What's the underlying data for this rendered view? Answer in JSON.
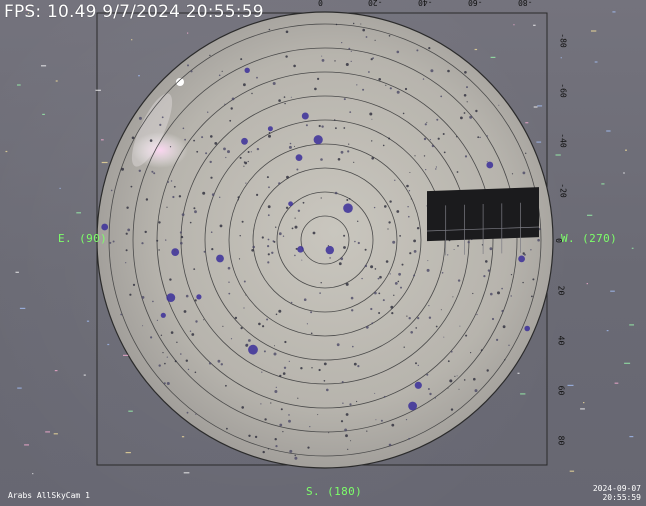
{
  "overlay": {
    "fps": "FPS: 10.49 9/7/2024 20:55:59",
    "east_label": "E. (90)",
    "west_label": "W. (270)",
    "south_label": "S. (180)",
    "camera_label": "Arabs AllSkyCam 1",
    "date_stamp": "2024-09-07",
    "time_stamp": "20:55:59"
  },
  "axes": {
    "top_ticks": [
      "0",
      "-20",
      "-40",
      "-60",
      "-80"
    ],
    "right_ticks": [
      "-80",
      "-60",
      "-40",
      "-20",
      "0",
      "20",
      "40",
      "60",
      "80"
    ]
  },
  "colors": {
    "direction_text": "#7dff6a",
    "fps_text": "#ffffff",
    "sky_dome": "#bdbab2"
  }
}
